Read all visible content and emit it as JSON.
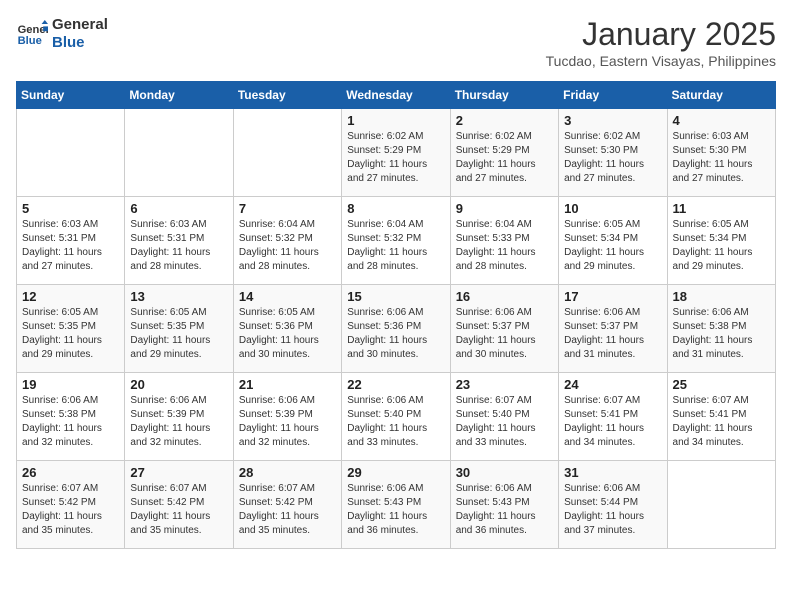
{
  "header": {
    "logo_line1": "General",
    "logo_line2": "Blue",
    "month_title": "January 2025",
    "location": "Tucdao, Eastern Visayas, Philippines"
  },
  "weekdays": [
    "Sunday",
    "Monday",
    "Tuesday",
    "Wednesday",
    "Thursday",
    "Friday",
    "Saturday"
  ],
  "weeks": [
    [
      {
        "day": "",
        "info": ""
      },
      {
        "day": "",
        "info": ""
      },
      {
        "day": "",
        "info": ""
      },
      {
        "day": "1",
        "info": "Sunrise: 6:02 AM\nSunset: 5:29 PM\nDaylight: 11 hours and 27 minutes."
      },
      {
        "day": "2",
        "info": "Sunrise: 6:02 AM\nSunset: 5:29 PM\nDaylight: 11 hours and 27 minutes."
      },
      {
        "day": "3",
        "info": "Sunrise: 6:02 AM\nSunset: 5:30 PM\nDaylight: 11 hours and 27 minutes."
      },
      {
        "day": "4",
        "info": "Sunrise: 6:03 AM\nSunset: 5:30 PM\nDaylight: 11 hours and 27 minutes."
      }
    ],
    [
      {
        "day": "5",
        "info": "Sunrise: 6:03 AM\nSunset: 5:31 PM\nDaylight: 11 hours and 27 minutes."
      },
      {
        "day": "6",
        "info": "Sunrise: 6:03 AM\nSunset: 5:31 PM\nDaylight: 11 hours and 28 minutes."
      },
      {
        "day": "7",
        "info": "Sunrise: 6:04 AM\nSunset: 5:32 PM\nDaylight: 11 hours and 28 minutes."
      },
      {
        "day": "8",
        "info": "Sunrise: 6:04 AM\nSunset: 5:32 PM\nDaylight: 11 hours and 28 minutes."
      },
      {
        "day": "9",
        "info": "Sunrise: 6:04 AM\nSunset: 5:33 PM\nDaylight: 11 hours and 28 minutes."
      },
      {
        "day": "10",
        "info": "Sunrise: 6:05 AM\nSunset: 5:34 PM\nDaylight: 11 hours and 29 minutes."
      },
      {
        "day": "11",
        "info": "Sunrise: 6:05 AM\nSunset: 5:34 PM\nDaylight: 11 hours and 29 minutes."
      }
    ],
    [
      {
        "day": "12",
        "info": "Sunrise: 6:05 AM\nSunset: 5:35 PM\nDaylight: 11 hours and 29 minutes."
      },
      {
        "day": "13",
        "info": "Sunrise: 6:05 AM\nSunset: 5:35 PM\nDaylight: 11 hours and 29 minutes."
      },
      {
        "day": "14",
        "info": "Sunrise: 6:05 AM\nSunset: 5:36 PM\nDaylight: 11 hours and 30 minutes."
      },
      {
        "day": "15",
        "info": "Sunrise: 6:06 AM\nSunset: 5:36 PM\nDaylight: 11 hours and 30 minutes."
      },
      {
        "day": "16",
        "info": "Sunrise: 6:06 AM\nSunset: 5:37 PM\nDaylight: 11 hours and 30 minutes."
      },
      {
        "day": "17",
        "info": "Sunrise: 6:06 AM\nSunset: 5:37 PM\nDaylight: 11 hours and 31 minutes."
      },
      {
        "day": "18",
        "info": "Sunrise: 6:06 AM\nSunset: 5:38 PM\nDaylight: 11 hours and 31 minutes."
      }
    ],
    [
      {
        "day": "19",
        "info": "Sunrise: 6:06 AM\nSunset: 5:38 PM\nDaylight: 11 hours and 32 minutes."
      },
      {
        "day": "20",
        "info": "Sunrise: 6:06 AM\nSunset: 5:39 PM\nDaylight: 11 hours and 32 minutes."
      },
      {
        "day": "21",
        "info": "Sunrise: 6:06 AM\nSunset: 5:39 PM\nDaylight: 11 hours and 32 minutes."
      },
      {
        "day": "22",
        "info": "Sunrise: 6:06 AM\nSunset: 5:40 PM\nDaylight: 11 hours and 33 minutes."
      },
      {
        "day": "23",
        "info": "Sunrise: 6:07 AM\nSunset: 5:40 PM\nDaylight: 11 hours and 33 minutes."
      },
      {
        "day": "24",
        "info": "Sunrise: 6:07 AM\nSunset: 5:41 PM\nDaylight: 11 hours and 34 minutes."
      },
      {
        "day": "25",
        "info": "Sunrise: 6:07 AM\nSunset: 5:41 PM\nDaylight: 11 hours and 34 minutes."
      }
    ],
    [
      {
        "day": "26",
        "info": "Sunrise: 6:07 AM\nSunset: 5:42 PM\nDaylight: 11 hours and 35 minutes."
      },
      {
        "day": "27",
        "info": "Sunrise: 6:07 AM\nSunset: 5:42 PM\nDaylight: 11 hours and 35 minutes."
      },
      {
        "day": "28",
        "info": "Sunrise: 6:07 AM\nSunset: 5:42 PM\nDaylight: 11 hours and 35 minutes."
      },
      {
        "day": "29",
        "info": "Sunrise: 6:06 AM\nSunset: 5:43 PM\nDaylight: 11 hours and 36 minutes."
      },
      {
        "day": "30",
        "info": "Sunrise: 6:06 AM\nSunset: 5:43 PM\nDaylight: 11 hours and 36 minutes."
      },
      {
        "day": "31",
        "info": "Sunrise: 6:06 AM\nSunset: 5:44 PM\nDaylight: 11 hours and 37 minutes."
      },
      {
        "day": "",
        "info": ""
      }
    ]
  ]
}
